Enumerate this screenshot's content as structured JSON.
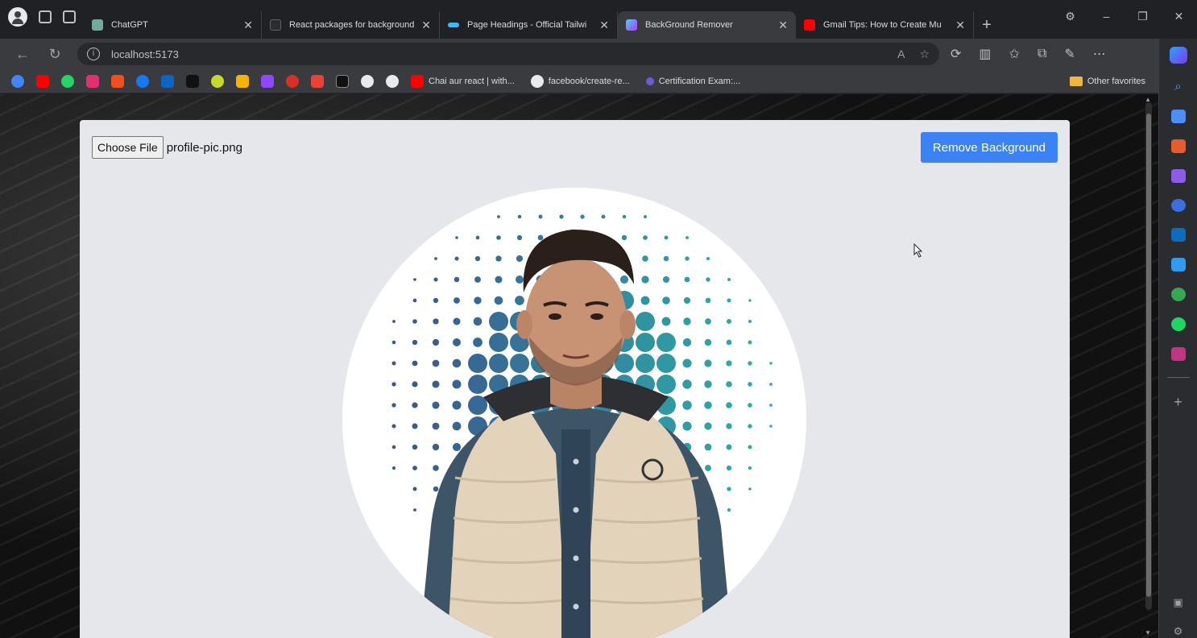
{
  "tabs": [
    {
      "title": "ChatGPT",
      "favicon": "chatgpt-icon",
      "color": "#74aa9c",
      "active": false
    },
    {
      "title": "React packages for background",
      "favicon": "page-icon",
      "color": "#5f6368",
      "active": false
    },
    {
      "title": "Page Headings - Official Tailwi",
      "favicon": "tailwind-icon",
      "color": "#38bdf8",
      "active": false
    },
    {
      "title": "BackGround Remover",
      "favicon": "vite-icon",
      "color": "#a855f7",
      "active": true
    },
    {
      "title": "Gmail Tips: How to Create Mu",
      "favicon": "youtube-icon",
      "color": "#ff0000",
      "active": false
    }
  ],
  "address": {
    "url": "localhost:5173"
  },
  "bookmarks": [
    {
      "label": "Chai aur react | with...",
      "icon": "youtube-icon",
      "color": "#ff0000"
    },
    {
      "label": "facebook/create-re...",
      "icon": "github-icon",
      "color": "#e8eaed"
    },
    {
      "label": "Certification Exam:...",
      "icon": "cert-icon",
      "color": "#6b5cd6"
    }
  ],
  "bookmark_icons": [
    {
      "name": "google-icon",
      "color": "#4285f4"
    },
    {
      "name": "youtube-icon",
      "color": "#ff0000"
    },
    {
      "name": "whatsapp-icon",
      "color": "#25d366"
    },
    {
      "name": "instagram-icon",
      "color": "#e1306c"
    },
    {
      "name": "figma-icon",
      "color": "#f24e1e"
    },
    {
      "name": "facebook-icon",
      "color": "#1877f2"
    },
    {
      "name": "linkedin-icon",
      "color": "#0a66c2"
    },
    {
      "name": "adobe-icon",
      "color": "#111111"
    },
    {
      "name": "tennis-icon",
      "color": "#c6d92a"
    },
    {
      "name": "bars-icon",
      "color": "#f4b400"
    },
    {
      "name": "chat-icon",
      "color": "#9146ff"
    },
    {
      "name": "shield-icon",
      "color": "#d93025"
    },
    {
      "name": "tools-icon",
      "color": "#ea4335"
    },
    {
      "name": "m-icon",
      "color": "#111111"
    },
    {
      "name": "github-icon",
      "color": "#e8eaed"
    },
    {
      "name": "github-icon",
      "color": "#e8eaed"
    }
  ],
  "other_favorites": "Other favorites",
  "app": {
    "choose_file_label": "Choose File",
    "file_name": "profile-pic.png",
    "remove_button": "Remove Background",
    "accent": "#3b82f6",
    "card_bg": "#e5e7eb"
  }
}
